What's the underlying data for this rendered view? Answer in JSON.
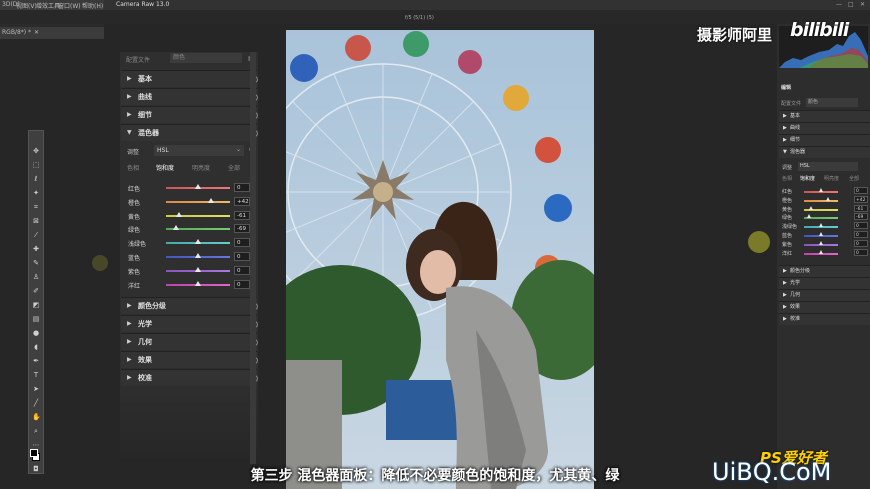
{
  "menubar": {
    "items": [
      "3D(D)",
      "视图(V)",
      "增效工具",
      "窗口(W)",
      "帮助(H)"
    ],
    "cr_title": "Camera Raw 13.0",
    "zoom_readout": "f/5 (5/1) (5)",
    "ps_tab": "RGB/8*) *"
  },
  "left_panel": {
    "profile_label": "配置文件",
    "profile_value": "颜色",
    "sections_top": [
      {
        "label": "基本"
      },
      {
        "label": "曲线"
      },
      {
        "label": "细节"
      },
      {
        "label": "混色器"
      }
    ],
    "adjust_label": "调整",
    "adjust_value": "HSL",
    "tabs": [
      "色相",
      "饱和度",
      "明亮度",
      "全部"
    ],
    "active_tab": "饱和度",
    "rows": [
      {
        "name": "红色",
        "value": "0",
        "frac": 0.5
      },
      {
        "name": "橙色",
        "value": "+42",
        "frac": 0.71
      },
      {
        "name": "黄色",
        "value": "-61",
        "frac": 0.2
      },
      {
        "name": "绿色",
        "value": "-69",
        "frac": 0.16
      },
      {
        "name": "浅绿色",
        "value": "0",
        "frac": 0.5
      },
      {
        "name": "蓝色",
        "value": "0",
        "frac": 0.5
      },
      {
        "name": "紫色",
        "value": "0",
        "frac": 0.5
      },
      {
        "name": "洋红",
        "value": "0",
        "frac": 0.5
      }
    ],
    "sections_bottom": [
      {
        "label": "颜色分级"
      },
      {
        "label": "光学"
      },
      {
        "label": "几何"
      },
      {
        "label": "效果"
      },
      {
        "label": "校准"
      }
    ]
  },
  "right_panel": {
    "title": "编辑",
    "profile_label": "配置文件",
    "profile_value": "颜色",
    "sections_top": [
      "基本",
      "曲线",
      "细节",
      "混色器"
    ],
    "adjust_label": "调整",
    "adjust_value": "HSL",
    "tabs": [
      "色相",
      "饱和度",
      "明亮度",
      "全部"
    ],
    "rows": [
      {
        "name": "红色",
        "value": "0",
        "frac": 0.5
      },
      {
        "name": "橙色",
        "value": "+42",
        "frac": 0.71
      },
      {
        "name": "黄色",
        "value": "-61",
        "frac": 0.2
      },
      {
        "name": "绿色",
        "value": "-69",
        "frac": 0.16
      },
      {
        "name": "浅绿色",
        "value": "0",
        "frac": 0.5
      },
      {
        "name": "蓝色",
        "value": "0",
        "frac": 0.5
      },
      {
        "name": "紫色",
        "value": "0",
        "frac": 0.5
      },
      {
        "name": "洋红",
        "value": "0",
        "frac": 0.5
      }
    ],
    "sections_bottom": [
      "颜色分级",
      "光学",
      "几何",
      "效果",
      "校准"
    ]
  },
  "subtitle": "第三步  混色器面板：降低不必要颜色的饱和度，尤其黄、绿",
  "watermarks": {
    "author": "摄影师阿里",
    "bilibili": "bilibili",
    "uibo": "UiBQ.CoM",
    "ps": "PS爱好者"
  },
  "colors": {
    "accent": "#4a90e2",
    "panel_bg": "#2f2f2f",
    "section_bg": "#333333"
  }
}
